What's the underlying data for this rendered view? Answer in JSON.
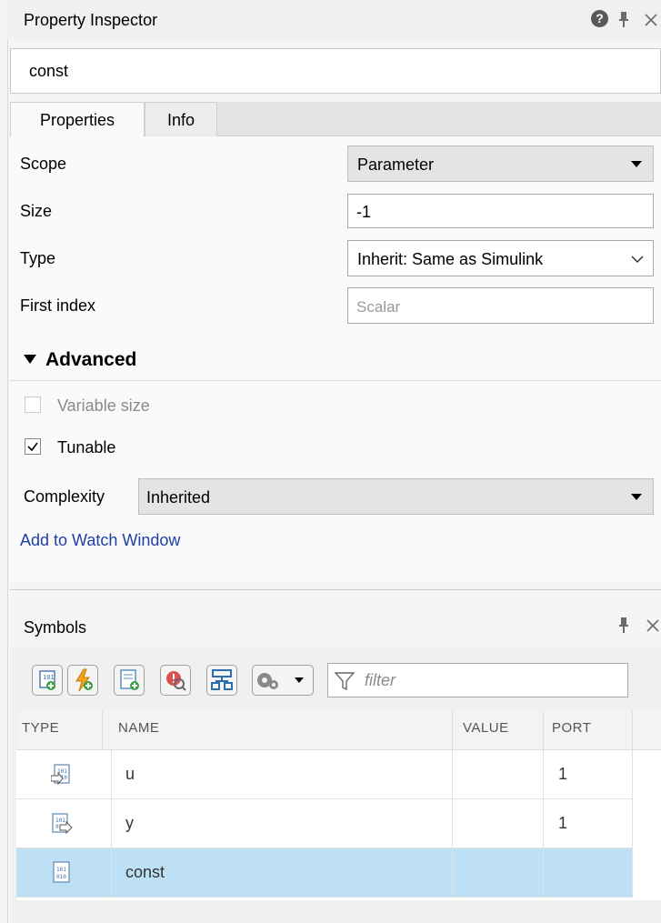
{
  "inspector": {
    "title": "Property Inspector",
    "help_glyph": "?",
    "object_name": "const",
    "tabs": [
      {
        "label": "Properties",
        "active": true
      },
      {
        "label": "Info",
        "active": false
      }
    ],
    "properties": {
      "scope_label": "Scope",
      "scope_value": "Parameter",
      "size_label": "Size",
      "size_value": "-1",
      "type_label": "Type",
      "type_value": "Inherit: Same as Simulink",
      "first_index_label": "First index",
      "first_index_placeholder": "Scalar"
    },
    "advanced": {
      "header": "Advanced",
      "variable_size_label": "Variable size",
      "variable_size_checked": false,
      "variable_size_enabled": false,
      "tunable_label": "Tunable",
      "tunable_checked": true,
      "complexity_label": "Complexity",
      "complexity_value": "Inherited",
      "watch_link": "Add to Watch Window"
    }
  },
  "symbols": {
    "title": "Symbols",
    "toolbar_icons": [
      "add-data-icon",
      "add-event-icon",
      "add-message-icon",
      "resolve-undefined-icon",
      "hierarchy-icon",
      "settings-icon"
    ],
    "filter_placeholder": "filter",
    "columns": [
      "TYPE",
      "NAME",
      "VALUE",
      "PORT"
    ],
    "rows": [
      {
        "type_icon": "input-data-icon",
        "name": "u",
        "value": "",
        "port": "1",
        "selected": false
      },
      {
        "type_icon": "output-data-icon",
        "name": "y",
        "value": "",
        "port": "1",
        "selected": false
      },
      {
        "type_icon": "parameter-data-icon",
        "name": "const",
        "value": "",
        "port": "",
        "selected": true
      }
    ]
  },
  "colors": {
    "link": "#1f3fa8",
    "selection": "#bde0f5"
  }
}
